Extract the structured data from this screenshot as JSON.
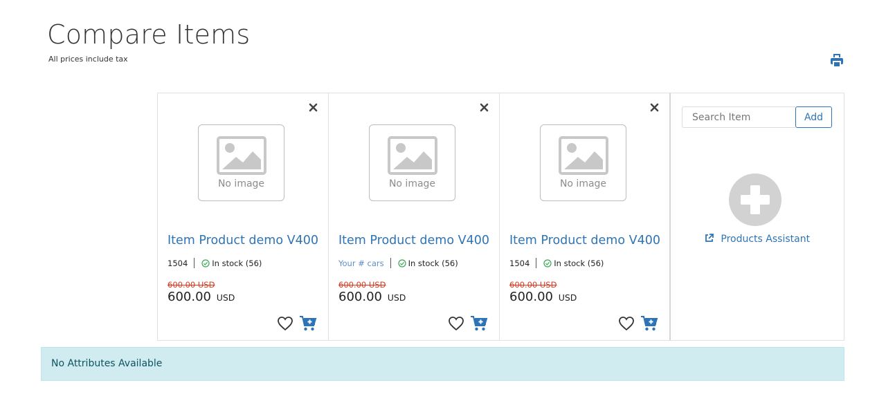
{
  "header": {
    "title": "Compare Items",
    "subtitle": "All prices include tax",
    "print_icon": "printer-icon"
  },
  "products": [
    {
      "name": "Item Product demo V400",
      "code": "1504",
      "code_is_link": false,
      "stock": "In stock (56)",
      "old_price": "600.00 USD",
      "price": "600.00",
      "currency": "USD",
      "image_placeholder": "No image"
    },
    {
      "name": "Item Product demo V400",
      "code": "Your # cars",
      "code_is_link": true,
      "stock": "In stock (56)",
      "old_price": "600.00 USD",
      "price": "600.00",
      "currency": "USD",
      "image_placeholder": "No image"
    },
    {
      "name": "Item Product demo V400",
      "code": "1504",
      "code_is_link": false,
      "stock": "In stock (56)",
      "old_price": "600.00 USD",
      "price": "600.00",
      "currency": "USD",
      "image_placeholder": "No image"
    }
  ],
  "assistant": {
    "search_placeholder": "Search Item",
    "search_value": "",
    "add_label": "Add",
    "link_label": "Products Assistant"
  },
  "alert": {
    "text": "No Attributes Available"
  },
  "colors": {
    "link": "#2e74b5",
    "old_price": "#d9381e",
    "in_stock": "#3aa655",
    "alert_bg": "#d1ecf1",
    "alert_text": "#0c5460"
  }
}
